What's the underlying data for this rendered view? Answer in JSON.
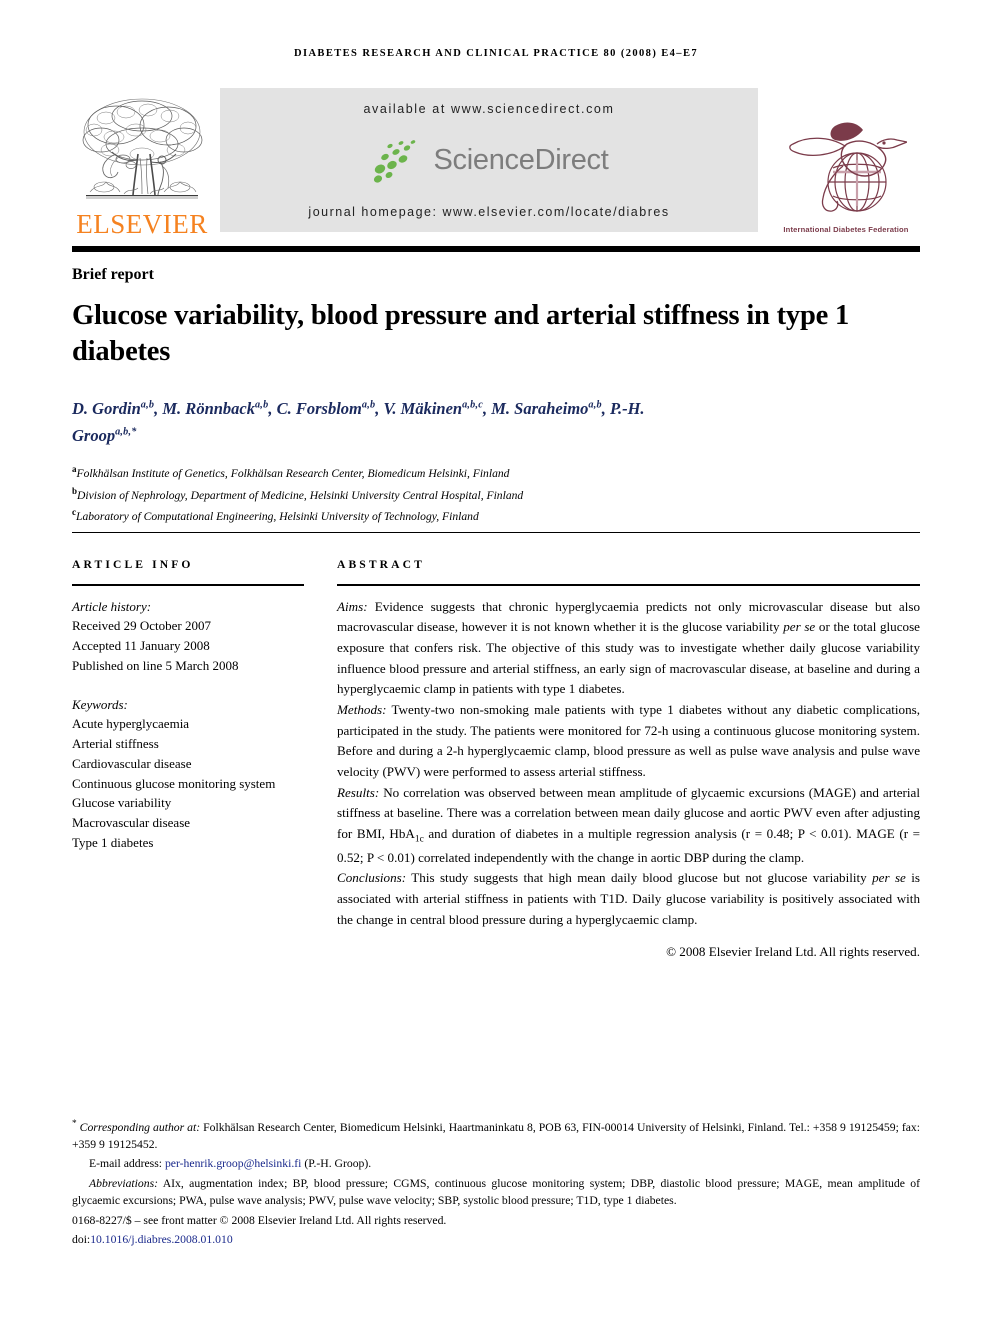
{
  "running_head": "Diabetes research and clinical practice 80 (2008) e4–e7",
  "masthead": {
    "publisher_wordmark": "ELSEVIER",
    "publisher_logo_icon": "elsevier-tree-logo",
    "available_at": "available at www.sciencedirect.com",
    "sciencedirect_wordmark": "ScienceDirect",
    "sciencedirect_logo_icon": "sciencedirect-leaf-dots-icon",
    "journal_homepage": "journal homepage: www.elsevier.com/locate/diabres",
    "society_logo_icon": "idf-hummingbird-globe-icon",
    "society_caption": "International Diabetes Federation",
    "colors": {
      "banner_background": "#E3E3E3",
      "elsevier_orange": "#F58220",
      "sciencedirect_green": "#6CB44C",
      "sciencedirect_gray": "#7D7D7D",
      "idf_maroon": "#7B3B4A",
      "author_navy": "#1B2A5E",
      "link_blue": "#1B2A8C"
    }
  },
  "article_type": "Brief report",
  "title": "Glucose variability, blood pressure and arterial stiffness in type 1 diabetes",
  "authors": [
    {
      "name": "D. Gordin",
      "marks": "a,b",
      "sep": ", "
    },
    {
      "name": "M. Rönnback",
      "marks": "a,b",
      "sep": ", "
    },
    {
      "name": "C. Forsblom",
      "marks": "a,b",
      "sep": ", "
    },
    {
      "name": "V. Mäkinen",
      "marks": "a,b,c",
      "sep": ", "
    },
    {
      "name": "M. Saraheimo",
      "marks": "a,b",
      "sep": ", "
    },
    {
      "name": "P.-H. Groop",
      "marks": "a,b,*",
      "sep": ""
    }
  ],
  "affiliations": [
    {
      "mark": "a",
      "text": "Folkhälsan Institute of Genetics, Folkhälsan Research Center, Biomedicum Helsinki, Finland"
    },
    {
      "mark": "b",
      "text": "Division of Nephrology, Department of Medicine, Helsinki University Central Hospital, Finland"
    },
    {
      "mark": "c",
      "text": "Laboratory of Computational Engineering, Helsinki University of Technology, Finland"
    }
  ],
  "article_info": {
    "heading": "Article info",
    "history_label": "Article history:",
    "history": [
      "Received 29 October 2007",
      "Accepted 11 January 2008",
      "Published on line 5 March 2008"
    ],
    "keywords_label": "Keywords:",
    "keywords": [
      "Acute hyperglycaemia",
      "Arterial stiffness",
      "Cardiovascular disease",
      "Continuous glucose monitoring system",
      "Glucose variability",
      "Macrovascular disease",
      "Type 1 diabetes"
    ]
  },
  "abstract": {
    "heading": "Abstract",
    "sections": [
      {
        "label": "Aims:",
        "text": " Evidence suggests that chronic hyperglycaemia predicts not only microvascular disease but also macrovascular disease, however it is not known whether it is the glucose variability per se or the total glucose exposure that confers risk. The objective of this study was to investigate whether daily glucose variability influence blood pressure and arterial stiffness, an early sign of macrovascular disease, at baseline and during a hyperglycaemic clamp in patients with type 1 diabetes."
      },
      {
        "label": "Methods:",
        "text": " Twenty-two non-smoking male patients with type 1 diabetes without any diabetic complications, participated in the study. The patients were monitored for 72-h using a continuous glucose monitoring system. Before and during a 2-h hyperglycaemic clamp, blood pressure as well as pulse wave analysis and pulse wave velocity (PWV) were performed to assess arterial stiffness."
      },
      {
        "label": "Results:",
        "text": " No correlation was observed between mean amplitude of glycaemic excursions (MAGE) and arterial stiffness at baseline. There was a correlation between mean daily glucose and aortic PWV even after adjusting for BMI, HbA1c and duration of diabetes in a multiple regression analysis (r = 0.48; P < 0.01). MAGE (r = 0.52; P < 0.01) correlated independently with the change in aortic DBP during the clamp."
      },
      {
        "label": "Conclusions:",
        "text": " This study suggests that high mean daily blood glucose but not glucose variability per se is associated with arterial stiffness in patients with T1D. Daily glucose variability is positively associated with the change in central blood pressure during a hyperglycaemic clamp."
      }
    ],
    "copyright": "© 2008 Elsevier Ireland Ltd. All rights reserved."
  },
  "footnotes": {
    "corresponding_label": "Corresponding author at:",
    "corresponding_text": " Folkhälsan Research Center, Biomedicum Helsinki, Haartmaninkatu 8, POB 63, FIN-00014 University of Helsinki, Finland. Tel.: +358 9 19125459; fax: +359 9 19125452.",
    "email_label": "E-mail address:",
    "email": "per-henrik.groop@helsinki.fi",
    "email_suffix": " (P.-H. Groop).",
    "abbreviations_label": "Abbreviations:",
    "abbreviations_text": " AIx, augmentation index; BP, blood pressure; CGMS, continuous glucose monitoring system; DBP, diastolic blood pressure; MAGE, mean amplitude of glycaemic excursions; PWA, pulse wave analysis; PWV, pulse wave velocity; SBP, systolic blood pressure; T1D, type 1 diabetes.",
    "front_matter": "0168-8227/$ – see front matter © 2008 Elsevier Ireland Ltd. All rights reserved.",
    "doi_label": "doi:",
    "doi": "10.1016/j.diabres.2008.01.010"
  }
}
